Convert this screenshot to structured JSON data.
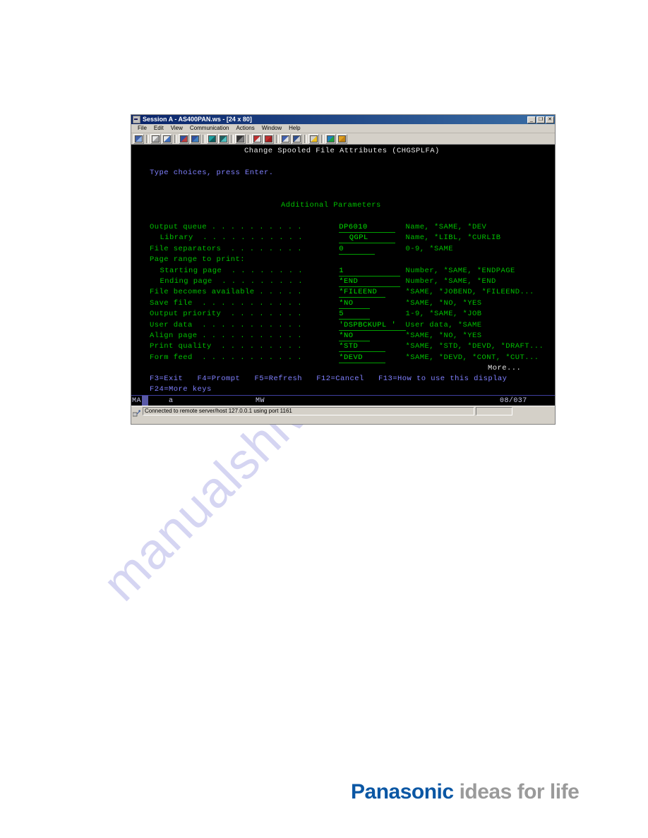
{
  "window": {
    "title": "Session A - AS400PAN.ws - [24 x 80]",
    "sysmenu_icon": "system-menu-icon",
    "buttons": {
      "minimize": "_",
      "restore": "❐",
      "close": "✕"
    }
  },
  "menubar": {
    "items": [
      {
        "label": "File"
      },
      {
        "label": "Edit"
      },
      {
        "label": "View"
      },
      {
        "label": "Communication"
      },
      {
        "label": "Actions"
      },
      {
        "label": "Window"
      },
      {
        "label": "Help"
      }
    ]
  },
  "toolbar": {
    "buttons": [
      {
        "name": "new-session-icon",
        "color1": "#4060a8",
        "color2": "#90b0e0"
      },
      {
        "name": "copy-icon",
        "color1": "#e8e8e8",
        "color2": "#a0a0a0"
      },
      {
        "name": "paste-icon",
        "color1": "#e8e8e8",
        "color2": "#4070c0"
      },
      {
        "name": "cut-icon",
        "color1": "#3050a0",
        "color2": "#c04040"
      },
      {
        "name": "copy-append-icon",
        "color1": "#3050a0",
        "color2": "#4080c0"
      },
      {
        "name": "display-session-icon",
        "color1": "#20a0a0",
        "color2": "#106060"
      },
      {
        "name": "printer-session-icon",
        "color1": "#206060",
        "color2": "#50c0c0"
      },
      {
        "name": "chart-icon",
        "color1": "#303030",
        "color2": "#808080"
      },
      {
        "name": "send-file-icon",
        "color1": "#c03030",
        "color2": "#e0e0e0"
      },
      {
        "name": "receive-file-icon",
        "color1": "#c03030",
        "color2": "#a02020"
      },
      {
        "name": "send-mail-icon",
        "color1": "#4060b0",
        "color2": "#e0e0e0"
      },
      {
        "name": "receive-mail-icon",
        "color1": "#305090",
        "color2": "#d0d0d0"
      },
      {
        "name": "security-icon",
        "color1": "#d0d0d0",
        "color2": "#f0c020"
      },
      {
        "name": "globe-icon",
        "color1": "#2080c0",
        "color2": "#20a040"
      },
      {
        "name": "edit-macro-icon",
        "color1": "#e0a020",
        "color2": "#c08010"
      }
    ]
  },
  "terminal": {
    "screen_title": "Change Spooled File Attributes (CHGSPLFA)",
    "instruction": "Type choices, press Enter.",
    "section_heading": "Additional Parameters",
    "more_indicator": "More...",
    "rows": [
      {
        "label": "Output queue . . . . . . . . . .",
        "value": "DP6010",
        "field_width": 11,
        "indent": 0,
        "hint": "Name, *SAME, *DEV"
      },
      {
        "label": "Library  . . . . . . . . . . .",
        "value": "QGPL",
        "field_width": 11,
        "indent": 2,
        "hint": "Name, *LIBL, *CURLIB"
      },
      {
        "label": "File separators  . . . . . . . .",
        "value": "0",
        "field_width": 7,
        "indent": 0,
        "hint": "0-9, *SAME"
      },
      {
        "label": "Page range to print:",
        "value": "",
        "field_width": 0,
        "indent": 0,
        "hint": ""
      },
      {
        "label": "Starting page  . . . . . . . .",
        "value": "1",
        "field_width": 12,
        "indent": 2,
        "hint": "Number, *SAME, *ENDPAGE"
      },
      {
        "label": "Ending page  . . . . . . . . .",
        "value": "*END",
        "field_width": 12,
        "indent": 2,
        "hint": "Number, *SAME, *END"
      },
      {
        "label": "File becomes available . . . . .",
        "value": "*FILEEND",
        "field_width": 9,
        "indent": 0,
        "hint": "*SAME, *JOBEND, *FILEEND..."
      },
      {
        "label": "Save file  . . . . . . . . . . .",
        "value": "*NO",
        "field_width": 6,
        "indent": 0,
        "hint": "*SAME, *NO, *YES"
      },
      {
        "label": "Output priority  . . . . . . . .",
        "value": "5",
        "field_width": 6,
        "indent": 0,
        "hint": "1-9, *SAME, *JOB"
      },
      {
        "label": "User data  . . . . . . . . . . .",
        "value": "'DSPBCKUPL '",
        "field_width": 13,
        "indent": 0,
        "hint": "User data, *SAME"
      },
      {
        "label": "Align page . . . . . . . . . . .",
        "value": "*NO",
        "field_width": 6,
        "indent": 0,
        "hint": "*SAME, *NO, *YES"
      },
      {
        "label": "Print quality  . . . . . . . . .",
        "value": "*STD",
        "field_width": 9,
        "indent": 0,
        "hint": "*SAME, *STD, *DEVD, *DRAFT..."
      },
      {
        "label": "Form feed  . . . . . . . . . . .",
        "value": "*DEVD",
        "field_width": 9,
        "indent": 0,
        "hint": "*SAME, *DEVD, *CONT, *CUT..."
      }
    ],
    "function_keys_line1": "F3=Exit   F4=Prompt   F5=Refresh   F12=Cancel   F13=How to use this display",
    "function_keys_line2": "F24=More keys"
  },
  "oia": {
    "system_indicator": "MA",
    "input_indicator": "a",
    "message_indicator": "MW",
    "cursor_position": "08/037"
  },
  "statusbar": {
    "connection_icon": "connection-icon",
    "message": "Connected to remote server/host 127.0.0.1 using port 1161",
    "right_pane": ""
  },
  "branding": {
    "brand": "Panasonic",
    "tagline": "ideas for life",
    "brand_color": "#0b57a4",
    "tagline_color": "#9a9a9a"
  },
  "watermark": {
    "text": "manualshiv.com",
    "color": "#d5d5f2"
  }
}
